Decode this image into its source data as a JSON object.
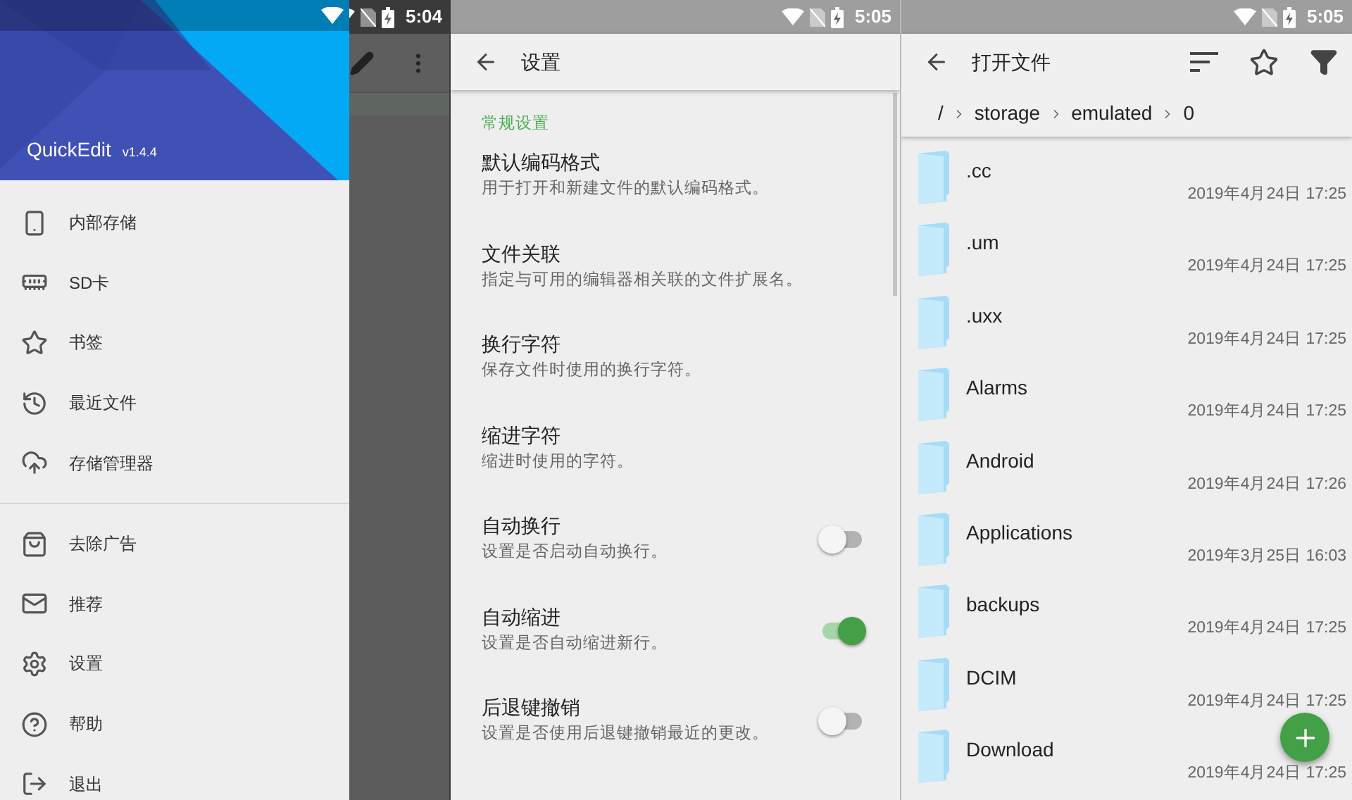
{
  "drawer_screen": {
    "time": "5:04",
    "app_name": "QuickEdit",
    "version": "v1.4.4",
    "sections": [
      {
        "items": [
          {
            "label": "内部存储"
          },
          {
            "label": "SD卡"
          },
          {
            "label": "书签"
          },
          {
            "label": "最近文件"
          },
          {
            "label": "存储管理器"
          }
        ]
      },
      {
        "items": [
          {
            "label": "去除广告"
          },
          {
            "label": "推荐"
          },
          {
            "label": "设置"
          },
          {
            "label": "帮助"
          },
          {
            "label": "退出"
          }
        ]
      }
    ]
  },
  "settings_screen": {
    "time": "5:05",
    "title": "设置",
    "section": "常规设置",
    "items": [
      {
        "kind": "text",
        "title": "默认编码格式",
        "subtitle": "用于打开和新建文件的默认编码格式。"
      },
      {
        "kind": "text",
        "title": "文件关联",
        "subtitle": "指定与可用的编辑器相关联的文件扩展名。"
      },
      {
        "kind": "text",
        "title": "换行字符",
        "subtitle": "保存文件时使用的换行字符。"
      },
      {
        "kind": "text",
        "title": "缩进字符",
        "subtitle": "缩进时使用的字符。"
      },
      {
        "kind": "switch",
        "title": "自动换行",
        "subtitle": "设置是否启动自动换行。",
        "on": false
      },
      {
        "kind": "switch",
        "title": "自动缩进",
        "subtitle": "设置是否自动缩进新行。",
        "on": true
      },
      {
        "kind": "switch",
        "title": "后退键撤销",
        "subtitle": "设置是否使用后退键撤销最近的更改。",
        "on": false
      }
    ]
  },
  "file_screen": {
    "time": "5:05",
    "title": "打开文件",
    "breadcrumb": [
      "/",
      "storage",
      "emulated",
      "0"
    ],
    "files": [
      {
        "name": ".cc",
        "date": "2019年4月24日 17:25"
      },
      {
        "name": ".um",
        "date": "2019年4月24日 17:25"
      },
      {
        "name": ".uxx",
        "date": "2019年4月24日 17:25"
      },
      {
        "name": "Alarms",
        "date": "2019年4月24日 17:25"
      },
      {
        "name": "Android",
        "date": "2019年4月24日 17:26"
      },
      {
        "name": "Applications",
        "date": "2019年3月25日 16:03"
      },
      {
        "name": "backups",
        "date": "2019年4月24日 17:25"
      },
      {
        "name": "DCIM",
        "date": "2019年4月24日 17:25"
      },
      {
        "name": "Download",
        "date": "2019年4月24日 17:25"
      }
    ]
  }
}
